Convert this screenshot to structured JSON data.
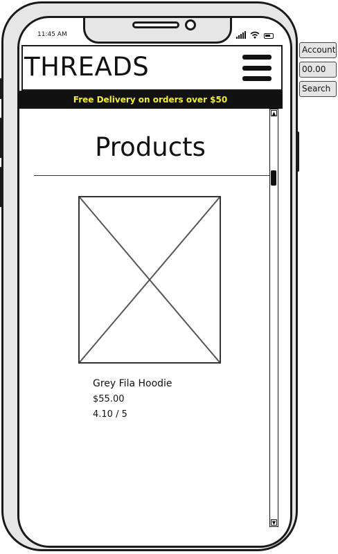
{
  "status_bar": {
    "time": "11:45 AM",
    "icons": [
      "signal-icon",
      "wifi-icon",
      "battery-icon"
    ]
  },
  "header": {
    "brand": "THREADS",
    "menu_icon": "hamburger-menu-icon"
  },
  "banner": {
    "text": "Free Delivery on orders over $50",
    "text_color": "#f5ef2a",
    "background": "#111111"
  },
  "main": {
    "title": "Products",
    "product": {
      "name": "Grey Fila Hoodie",
      "price": "$55.00",
      "rating": "4.10 / 5",
      "image_icon": "image-placeholder-icon"
    }
  },
  "scrollbar": {
    "up_arrow": "▲",
    "down_arrow": "▼"
  },
  "side_panel": {
    "account": "Account",
    "value": "00.00",
    "search": "Search"
  }
}
